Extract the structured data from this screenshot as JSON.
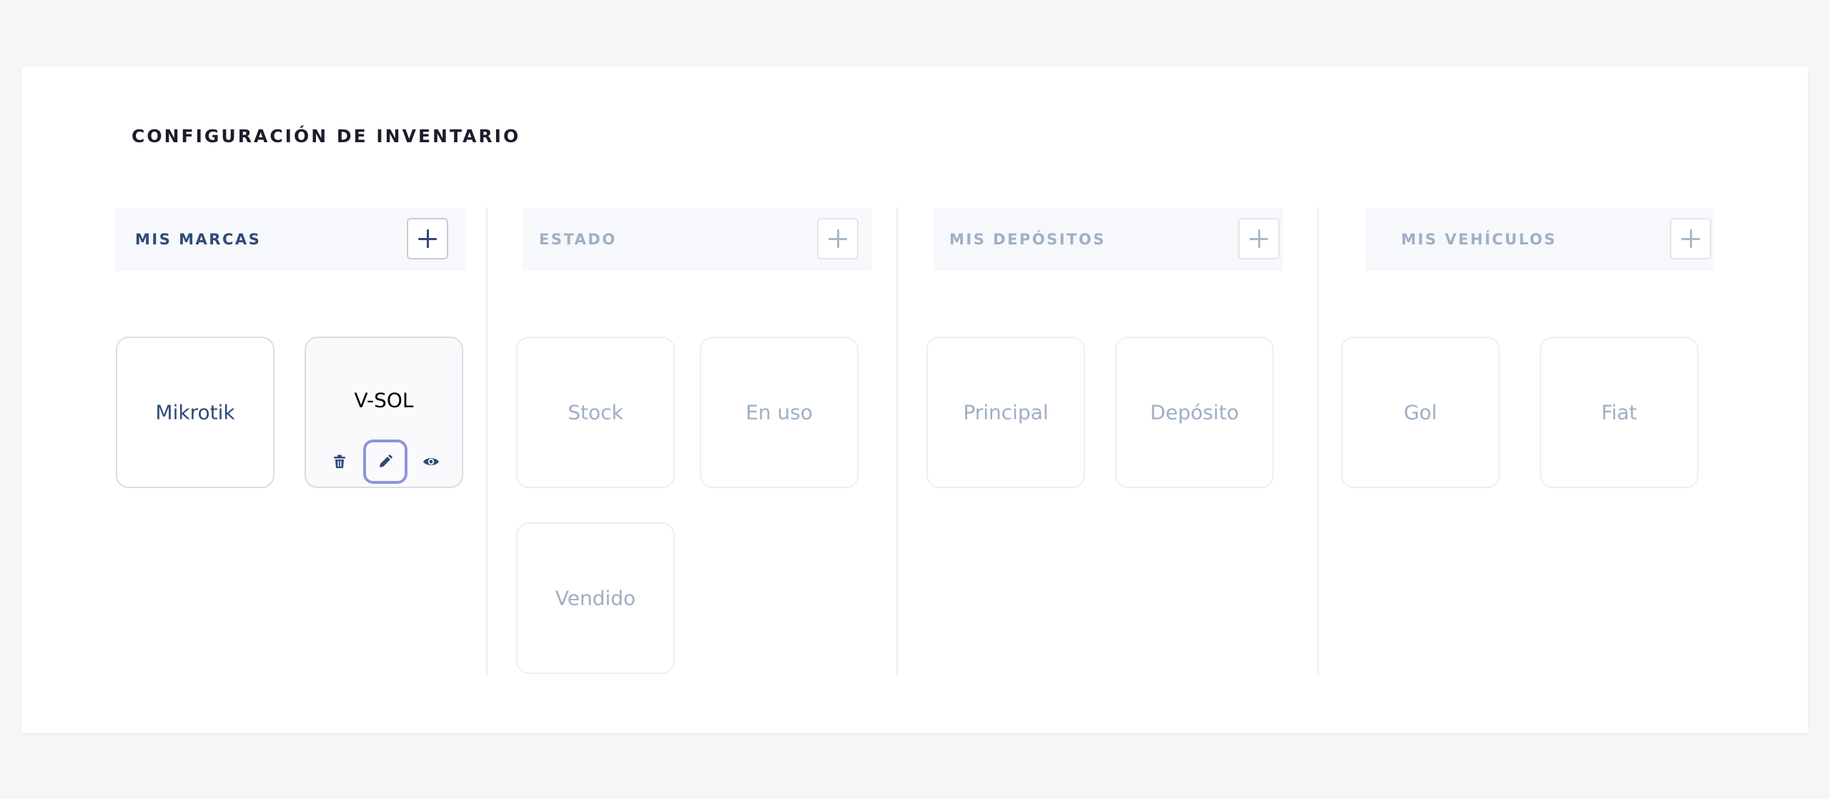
{
  "page": {
    "title": "CONFIGURACIÓN DE INVENTARIO"
  },
  "columns": [
    {
      "title": "MIS MARCAS",
      "items": [
        "Mikrotik",
        "V-SOL"
      ]
    },
    {
      "title": "ESTADO",
      "items": [
        "Stock",
        "En uso",
        "Vendido"
      ]
    },
    {
      "title": "MIS DEPÓSITOS",
      "items": [
        "Principal",
        "Depósito"
      ]
    },
    {
      "title": "MIS VEHÍCULOS",
      "items": [
        "Gol",
        "Fiat"
      ]
    }
  ],
  "card_actions": {
    "icons": [
      "trash-icon",
      "pencil-icon",
      "eye-icon"
    ]
  },
  "colors": {
    "accent": "#2e4a78",
    "muted": "#9fb0c5",
    "focus_ring": "#8f93e0",
    "background": "#f6f6f7",
    "panel": "#ffffff"
  }
}
